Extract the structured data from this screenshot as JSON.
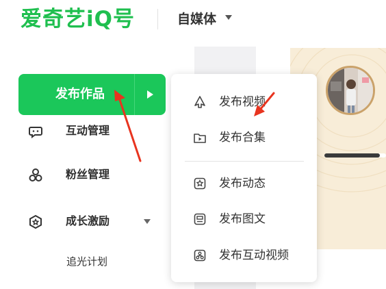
{
  "header": {
    "logo_text": "爱奇艺iQ号",
    "media_label": "自媒体"
  },
  "publish_button": {
    "label": "发布作品"
  },
  "sidebar": {
    "items": [
      {
        "label": "互动管理",
        "icon": "chat-icon"
      },
      {
        "label": "粉丝管理",
        "icon": "users-icon"
      },
      {
        "label": "成长激励",
        "icon": "badge-icon"
      }
    ],
    "subitem": "追光计划"
  },
  "dropdown": {
    "items": [
      {
        "label": "发布视频",
        "icon": "upload-icon"
      },
      {
        "label": "发布合集",
        "icon": "folder-play-icon"
      },
      {
        "label": "发布动态",
        "icon": "status-icon"
      },
      {
        "label": "发布图文",
        "icon": "article-icon"
      },
      {
        "label": "发布互动视频",
        "icon": "interactive-video-icon"
      }
    ]
  },
  "banner": {
    "progress": 0.9
  },
  "colors": {
    "brand_green": "#1fbf4f",
    "button_green": "#1bc75a",
    "annotation_red": "#e8341f"
  }
}
